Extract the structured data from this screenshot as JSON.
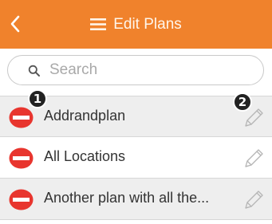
{
  "header": {
    "title": "Edit Plans",
    "back_icon": "chevron-left-icon",
    "menu_icon": "hamburger-icon",
    "background_color": "#f0822c"
  },
  "search": {
    "placeholder": "Search",
    "value": ""
  },
  "plans": [
    {
      "label": "Addrandplan",
      "shaded": true
    },
    {
      "label": "All Locations",
      "shaded": false
    },
    {
      "label": "Another plan with all the...",
      "shaded": true
    }
  ],
  "annotations": {
    "marker_1": "1",
    "marker_2": "2"
  },
  "colors": {
    "remove_red": "#e8352e",
    "row_shade": "#eeeeee"
  }
}
